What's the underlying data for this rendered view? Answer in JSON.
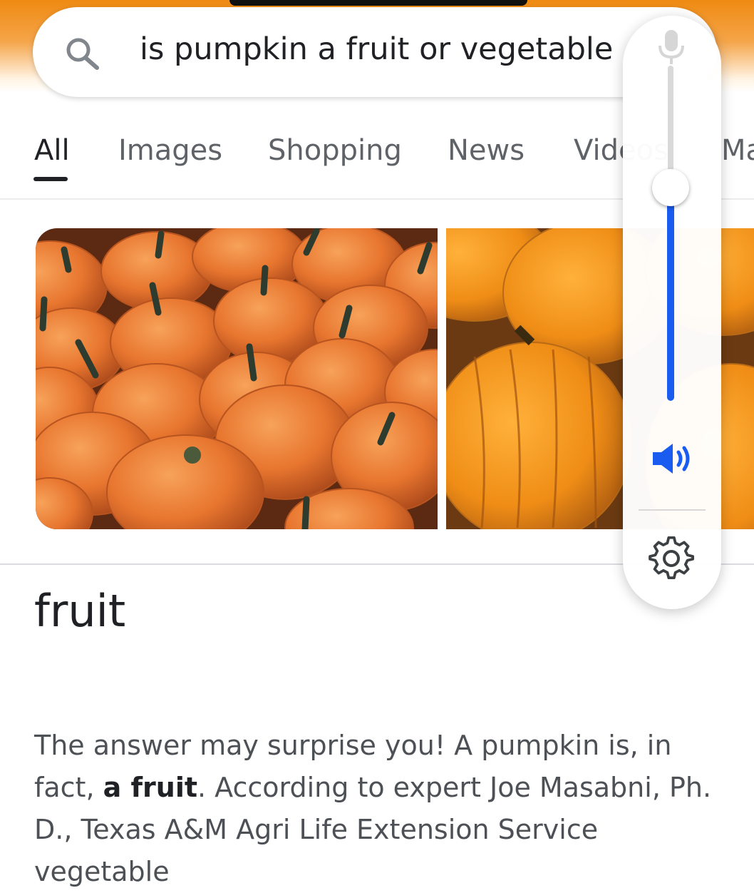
{
  "search": {
    "query": "is pumpkin a fruit or vegetable",
    "icon": "search-icon"
  },
  "tabs": [
    {
      "label": "All",
      "active": true
    },
    {
      "label": "Images",
      "active": false
    },
    {
      "label": "Shopping",
      "active": false
    },
    {
      "label": "News",
      "active": false
    },
    {
      "label": "Videos",
      "active": false
    },
    {
      "label": "Ma",
      "active": false
    }
  ],
  "answer": {
    "title": "fruit",
    "snippet_start": "The answer may surprise you! A pumpkin is, in fact, ",
    "snippet_bold": "a fruit",
    "snippet_rest": ". According to expert Joe Masabni, Ph. D., Texas A&M Agri Life Extension Service vegetable"
  },
  "volume_panel": {
    "level": 0.55,
    "icons": [
      "mic-icon",
      "speaker-icon",
      "gear-icon"
    ],
    "accent_color": "#1a5cf0"
  },
  "colors": {
    "header_orange": "#ef8a12",
    "text_primary": "#202124",
    "text_secondary": "#5f6368"
  }
}
